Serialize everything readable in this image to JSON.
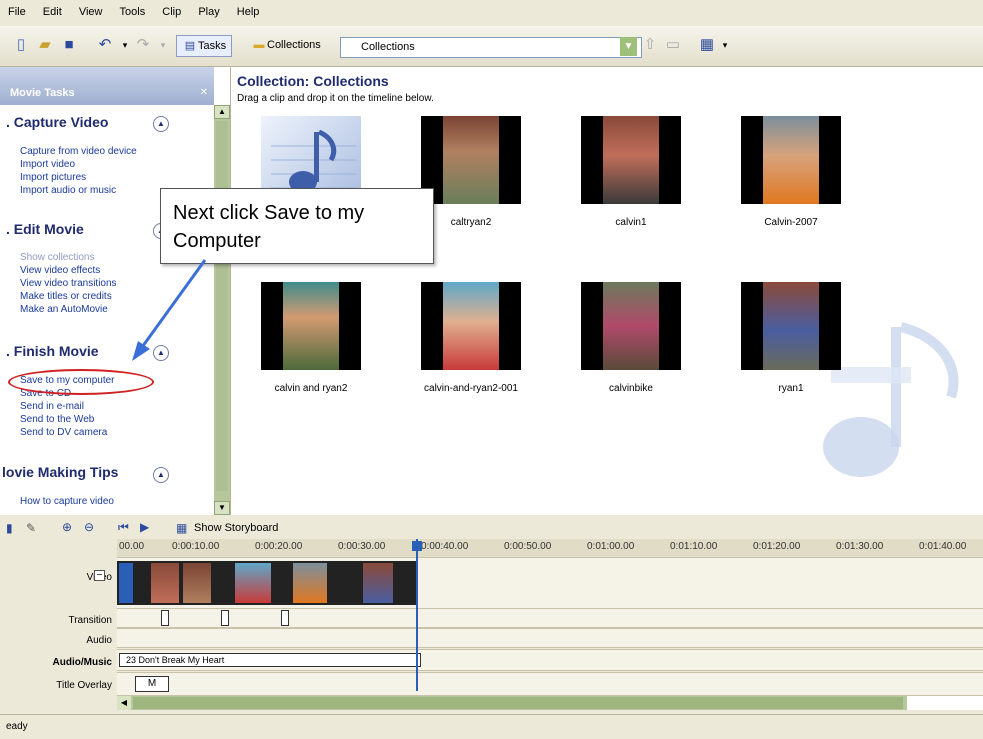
{
  "menu": [
    "File",
    "Edit",
    "View",
    "Tools",
    "Clip",
    "Play",
    "Help"
  ],
  "toolbar": {
    "tasks_label": "Tasks",
    "collections_label": "Collections",
    "combo_value": "Collections"
  },
  "taskpane": {
    "title": "Movie Tasks",
    "sections": [
      {
        "title": ". Capture Video",
        "links": [
          "Capture from video device",
          "Import video",
          "Import pictures",
          "Import audio or music"
        ]
      },
      {
        "title": ". Edit Movie",
        "links": [
          "Show collections",
          "View video effects",
          "View video transitions",
          "Make titles or credits",
          "Make an AutoMovie"
        ]
      },
      {
        "title": ". Finish Movie",
        "links": [
          "Save to my computer",
          "Save to CD",
          "Send in e-mail",
          "Send to the Web",
          "Send to DV camera"
        ]
      },
      {
        "title": "lovie Making Tips",
        "links": [
          "How to capture video"
        ]
      }
    ]
  },
  "collection": {
    "title": "Collection: Collections",
    "subtitle": "Drag a clip and drop it on the timeline below.",
    "clips": [
      "",
      "caltryan2",
      "calvin1",
      "Calvin-2007",
      "calvin and ryan2",
      "calvin-and-ryan2-001",
      "calvinbike",
      "ryan1"
    ]
  },
  "callout": {
    "text": "Next click Save to my Computer"
  },
  "timeline_toolbar": {
    "storyboard_label": "Show Storyboard"
  },
  "timeline": {
    "ruler": [
      "00.00",
      "0:00:10.00",
      "0:00:20.00",
      "0:00:30.00",
      "0:00:40.00",
      "0:00:50.00",
      "0:01:00.00",
      "0:01:10.00",
      "0:01:20.00",
      "0:01:30.00",
      "0:01:40.00"
    ],
    "tracks": [
      "Video",
      "Transition",
      "Audio",
      "Audio/Music",
      "Title Overlay"
    ],
    "audio_clip": "23 Don't Break My Heart",
    "title_clip": "M"
  },
  "status": "eady",
  "colors": {
    "accent": "#1f2b6e",
    "link": "#1a3a9b",
    "highlight_circle": "#d02020",
    "arrow": "#3b6fd8"
  }
}
